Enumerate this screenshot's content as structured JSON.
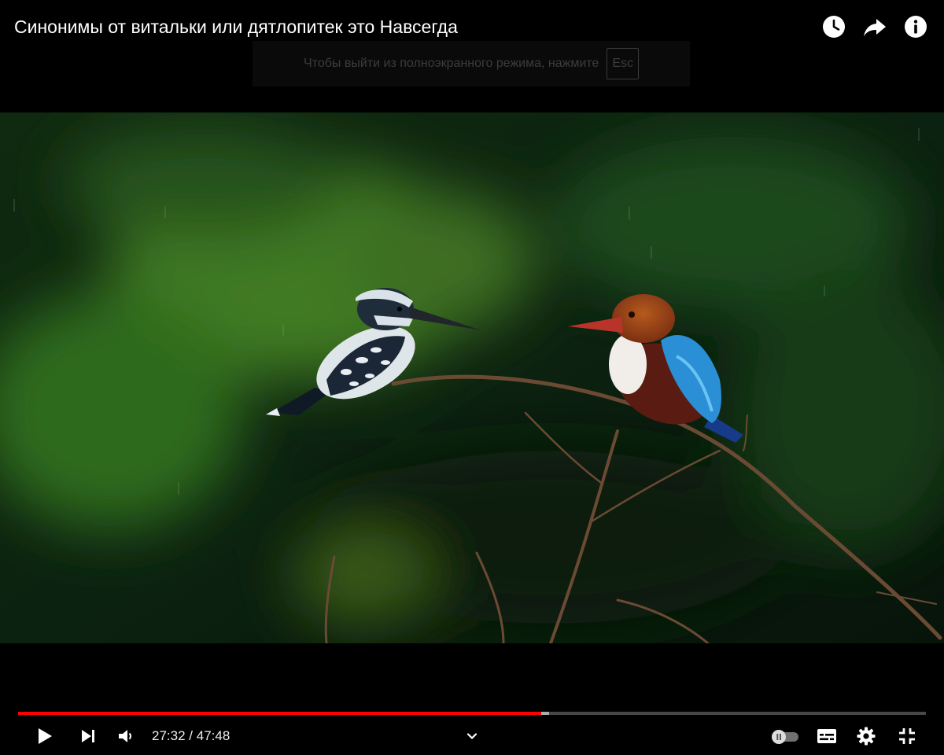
{
  "video": {
    "title": "Синонимы от витальки или дятлопитек это Навсегда"
  },
  "top_actions": {
    "watch_later_icon": "clock-icon",
    "share_icon": "share-arrow-icon",
    "info_icon": "info-icon"
  },
  "fullscreen_notice": {
    "text": "Чтобы выйти из полноэкранного режима, нажмите",
    "key": "Esc"
  },
  "player": {
    "current_time": "27:32",
    "separator": "/",
    "duration": "47:48",
    "played_fraction": 0.576,
    "buffered_fraction": 0.585,
    "colors": {
      "played": "#ff0000",
      "accent": "#ffffff"
    },
    "controls": {
      "play_icon": "play-icon",
      "next_icon": "skip-next-icon",
      "volume_icon": "volume-icon",
      "chapters_icon": "chevron-down-icon",
      "autoplay_icon": "autoplay-toggle-icon",
      "subtitles_icon": "subtitles-icon",
      "settings_icon": "gear-icon",
      "exit_fullscreen_icon": "exit-fullscreen-icon"
    }
  }
}
